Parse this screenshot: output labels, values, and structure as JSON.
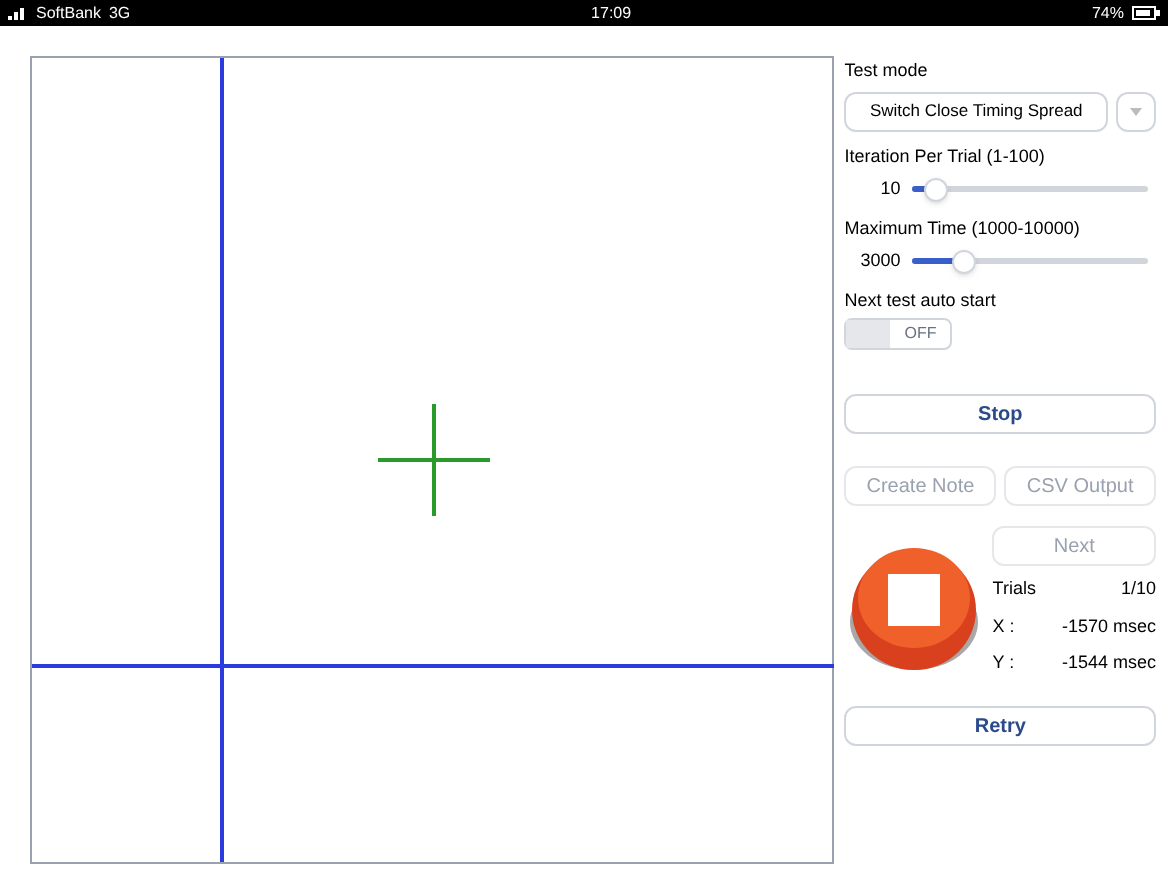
{
  "status_bar": {
    "carrier": "SoftBank",
    "network": "3G",
    "time": "17:09",
    "battery": "74%"
  },
  "test_mode": {
    "label": "Test mode",
    "value": "Switch Close Timing Spread"
  },
  "sliders": [
    {
      "label": "Iteration Per Trial (1-100)",
      "reading": "10",
      "level": 0.1
    },
    {
      "label": "Maximum Time (1000-10000)",
      "reading": "3000",
      "level": 0.22
    }
  ],
  "auto_start": {
    "label": "Next test auto start",
    "on": false,
    "state_text": "OFF"
  },
  "buttons": [
    {
      "label": "Stop",
      "disabled": false
    },
    {
      "label": "Create Note",
      "disabled": true
    },
    {
      "label": "CSV Output",
      "disabled": true
    },
    {
      "label": "Next",
      "disabled": true
    },
    {
      "label": "Retry",
      "disabled": false
    }
  ],
  "results": [
    {
      "label": "Trials",
      "value": "1/10"
    },
    {
      "label": "X :",
      "value": "-1570 msec"
    },
    {
      "label": "Y :",
      "value": "-1544 msec"
    }
  ]
}
